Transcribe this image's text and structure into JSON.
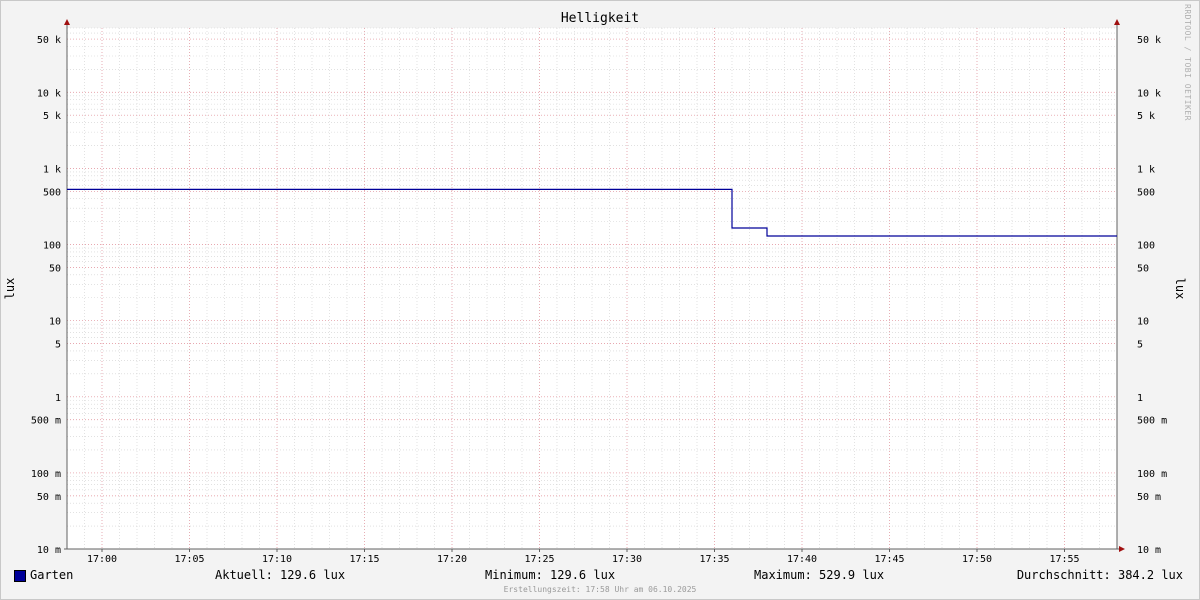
{
  "chart_data": {
    "type": "line",
    "title": "Helligkeit",
    "ylabel": "lux",
    "y_scale": "log",
    "ylim": [
      0.01,
      70000
    ],
    "xlim": [
      "16:58",
      "17:58"
    ],
    "x_ticks": [
      "17:00",
      "17:05",
      "17:10",
      "17:15",
      "17:20",
      "17:25",
      "17:30",
      "17:35",
      "17:40",
      "17:45",
      "17:50",
      "17:55"
    ],
    "y_ticks": [
      {
        "value": 50000,
        "label": "50 k"
      },
      {
        "value": 10000,
        "label": "10 k"
      },
      {
        "value": 5000,
        "label": "5 k"
      },
      {
        "value": 1000,
        "label": "1 k"
      },
      {
        "value": 500,
        "label": "500"
      },
      {
        "value": 100,
        "label": "100"
      },
      {
        "value": 50,
        "label": "50"
      },
      {
        "value": 10,
        "label": "10"
      },
      {
        "value": 5,
        "label": "5"
      },
      {
        "value": 1,
        "label": "1"
      },
      {
        "value": 0.5,
        "label": "500 m"
      },
      {
        "value": 0.1,
        "label": "100 m"
      },
      {
        "value": 0.05,
        "label": "50 m"
      },
      {
        "value": 0.01,
        "label": "10 m"
      }
    ],
    "grid": true,
    "legend_placement": "bottom-left",
    "series": [
      {
        "name": "Garten",
        "color": "#000099",
        "points": [
          {
            "x": "16:58",
            "y": 529.9
          },
          {
            "x": "17:36",
            "y": 529.9
          },
          {
            "x": "17:36",
            "y": 165
          },
          {
            "x": "17:38",
            "y": 165
          },
          {
            "x": "17:38",
            "y": 129.6
          },
          {
            "x": "17:58",
            "y": 129.6
          }
        ]
      }
    ]
  },
  "legend": {
    "series_name": "Garten",
    "current": "Aktuell: 129.6 lux",
    "minimum": "Minimum: 129.6 lux",
    "maximum": "Maximum: 529.9 lux",
    "average": "Durchschnitt: 384.2 lux"
  },
  "watermark": "RRDTOOL / TOBI OETIKER",
  "footer": "Erstellungszeit: 17:58 Uhr am 06.10.2025",
  "colors": {
    "background": "#f3f3f3",
    "plot_background": "#ffffff",
    "major_grid": "#e8a0a8",
    "minor_grid": "#d0d0d0",
    "axis": "#606060",
    "arrow": "#a01010",
    "series": "#000099"
  }
}
